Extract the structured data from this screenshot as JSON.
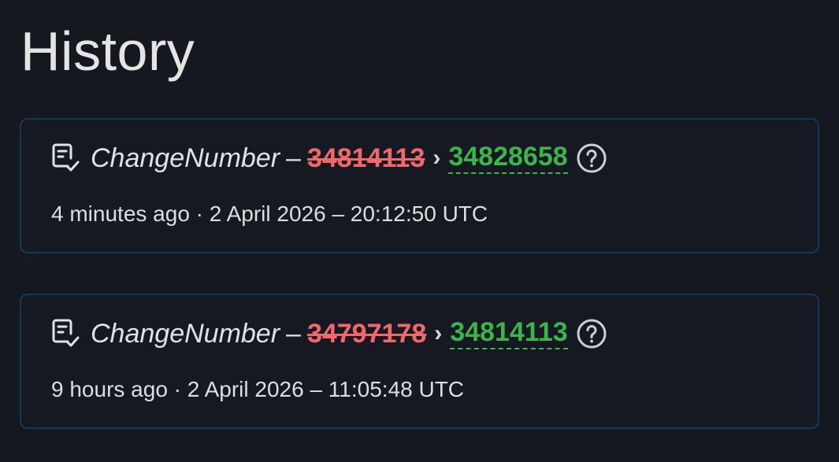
{
  "page": {
    "title": "History"
  },
  "entries": [
    {
      "icon": "document-check-icon",
      "field": "ChangeNumber",
      "separator": "–",
      "old_value": "34814113",
      "arrow": "›",
      "new_value": "34828658",
      "help_icon": "question-circle-icon",
      "meta": "4 minutes ago · 2 April 2026 – 20:12:50 UTC"
    },
    {
      "icon": "document-check-icon",
      "field": "ChangeNumber",
      "separator": "–",
      "old_value": "34797178",
      "arrow": "›",
      "new_value": "34814113",
      "help_icon": "question-circle-icon",
      "meta": "9 hours ago · 2 April 2026 – 11:05:48 UTC"
    }
  ],
  "colors": {
    "background": "#16181f",
    "card_border": "#133a5a",
    "old_value": "#f0686a",
    "new_value": "#3bb54a",
    "text": "#e2e2e2"
  }
}
